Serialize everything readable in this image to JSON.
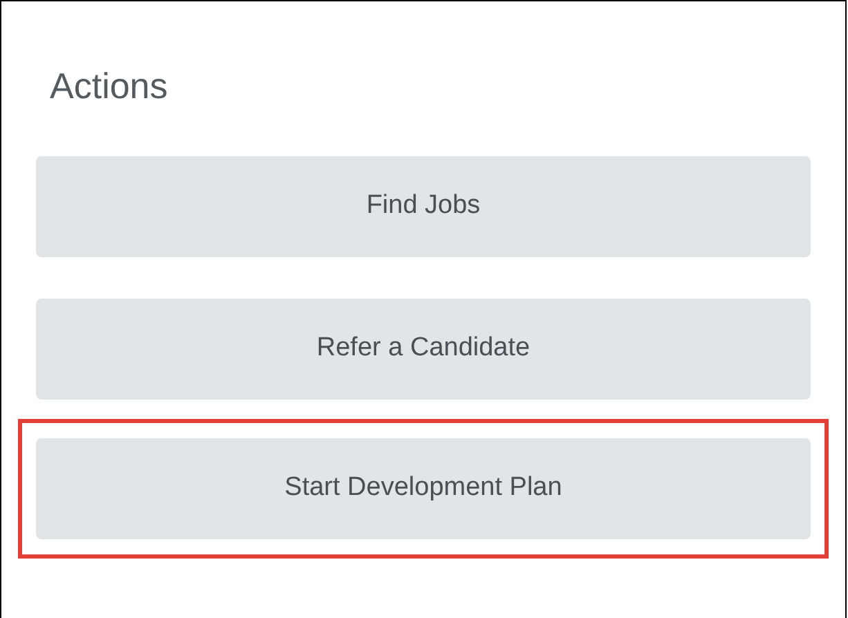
{
  "title": "Actions",
  "actions": [
    {
      "label": "Find Jobs",
      "highlighted": false
    },
    {
      "label": "Refer a Candidate",
      "highlighted": false
    },
    {
      "label": "Start Development Plan",
      "highlighted": true
    }
  ]
}
